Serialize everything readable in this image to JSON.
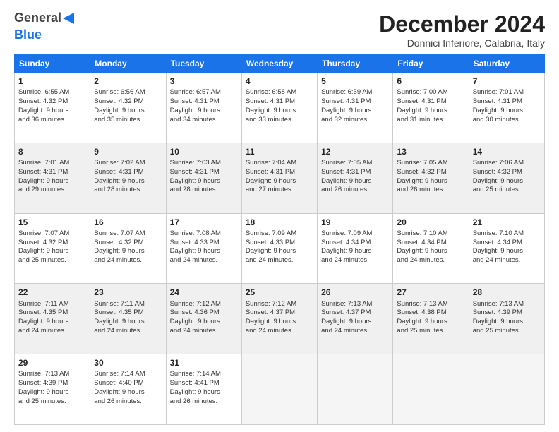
{
  "header": {
    "logo_general": "General",
    "logo_blue": "Blue",
    "title": "December 2024",
    "subtitle": "Donnici Inferiore, Calabria, Italy"
  },
  "columns": [
    "Sunday",
    "Monday",
    "Tuesday",
    "Wednesday",
    "Thursday",
    "Friday",
    "Saturday"
  ],
  "weeks": [
    [
      {
        "day": "1",
        "info": "Sunrise: 6:55 AM\nSunset: 4:32 PM\nDaylight: 9 hours\nand 36 minutes."
      },
      {
        "day": "2",
        "info": "Sunrise: 6:56 AM\nSunset: 4:32 PM\nDaylight: 9 hours\nand 35 minutes."
      },
      {
        "day": "3",
        "info": "Sunrise: 6:57 AM\nSunset: 4:31 PM\nDaylight: 9 hours\nand 34 minutes."
      },
      {
        "day": "4",
        "info": "Sunrise: 6:58 AM\nSunset: 4:31 PM\nDaylight: 9 hours\nand 33 minutes."
      },
      {
        "day": "5",
        "info": "Sunrise: 6:59 AM\nSunset: 4:31 PM\nDaylight: 9 hours\nand 32 minutes."
      },
      {
        "day": "6",
        "info": "Sunrise: 7:00 AM\nSunset: 4:31 PM\nDaylight: 9 hours\nand 31 minutes."
      },
      {
        "day": "7",
        "info": "Sunrise: 7:01 AM\nSunset: 4:31 PM\nDaylight: 9 hours\nand 30 minutes."
      }
    ],
    [
      {
        "day": "8",
        "info": "Sunrise: 7:01 AM\nSunset: 4:31 PM\nDaylight: 9 hours\nand 29 minutes."
      },
      {
        "day": "9",
        "info": "Sunrise: 7:02 AM\nSunset: 4:31 PM\nDaylight: 9 hours\nand 28 minutes."
      },
      {
        "day": "10",
        "info": "Sunrise: 7:03 AM\nSunset: 4:31 PM\nDaylight: 9 hours\nand 28 minutes."
      },
      {
        "day": "11",
        "info": "Sunrise: 7:04 AM\nSunset: 4:31 PM\nDaylight: 9 hours\nand 27 minutes."
      },
      {
        "day": "12",
        "info": "Sunrise: 7:05 AM\nSunset: 4:31 PM\nDaylight: 9 hours\nand 26 minutes."
      },
      {
        "day": "13",
        "info": "Sunrise: 7:05 AM\nSunset: 4:32 PM\nDaylight: 9 hours\nand 26 minutes."
      },
      {
        "day": "14",
        "info": "Sunrise: 7:06 AM\nSunset: 4:32 PM\nDaylight: 9 hours\nand 25 minutes."
      }
    ],
    [
      {
        "day": "15",
        "info": "Sunrise: 7:07 AM\nSunset: 4:32 PM\nDaylight: 9 hours\nand 25 minutes."
      },
      {
        "day": "16",
        "info": "Sunrise: 7:07 AM\nSunset: 4:32 PM\nDaylight: 9 hours\nand 24 minutes."
      },
      {
        "day": "17",
        "info": "Sunrise: 7:08 AM\nSunset: 4:33 PM\nDaylight: 9 hours\nand 24 minutes."
      },
      {
        "day": "18",
        "info": "Sunrise: 7:09 AM\nSunset: 4:33 PM\nDaylight: 9 hours\nand 24 minutes."
      },
      {
        "day": "19",
        "info": "Sunrise: 7:09 AM\nSunset: 4:34 PM\nDaylight: 9 hours\nand 24 minutes."
      },
      {
        "day": "20",
        "info": "Sunrise: 7:10 AM\nSunset: 4:34 PM\nDaylight: 9 hours\nand 24 minutes."
      },
      {
        "day": "21",
        "info": "Sunrise: 7:10 AM\nSunset: 4:34 PM\nDaylight: 9 hours\nand 24 minutes."
      }
    ],
    [
      {
        "day": "22",
        "info": "Sunrise: 7:11 AM\nSunset: 4:35 PM\nDaylight: 9 hours\nand 24 minutes."
      },
      {
        "day": "23",
        "info": "Sunrise: 7:11 AM\nSunset: 4:35 PM\nDaylight: 9 hours\nand 24 minutes."
      },
      {
        "day": "24",
        "info": "Sunrise: 7:12 AM\nSunset: 4:36 PM\nDaylight: 9 hours\nand 24 minutes."
      },
      {
        "day": "25",
        "info": "Sunrise: 7:12 AM\nSunset: 4:37 PM\nDaylight: 9 hours\nand 24 minutes."
      },
      {
        "day": "26",
        "info": "Sunrise: 7:13 AM\nSunset: 4:37 PM\nDaylight: 9 hours\nand 24 minutes."
      },
      {
        "day": "27",
        "info": "Sunrise: 7:13 AM\nSunset: 4:38 PM\nDaylight: 9 hours\nand 25 minutes."
      },
      {
        "day": "28",
        "info": "Sunrise: 7:13 AM\nSunset: 4:39 PM\nDaylight: 9 hours\nand 25 minutes."
      }
    ],
    [
      {
        "day": "29",
        "info": "Sunrise: 7:13 AM\nSunset: 4:39 PM\nDaylight: 9 hours\nand 25 minutes."
      },
      {
        "day": "30",
        "info": "Sunrise: 7:14 AM\nSunset: 4:40 PM\nDaylight: 9 hours\nand 26 minutes."
      },
      {
        "day": "31",
        "info": "Sunrise: 7:14 AM\nSunset: 4:41 PM\nDaylight: 9 hours\nand 26 minutes."
      },
      null,
      null,
      null,
      null
    ]
  ]
}
